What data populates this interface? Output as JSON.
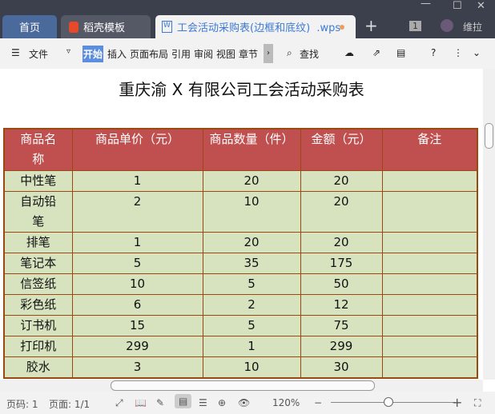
{
  "tabs": [
    {
      "label": "首页"
    },
    {
      "label": "稻壳模板"
    },
    {
      "label": "工会活动采购表(边框和底纹)  .wps"
    }
  ],
  "user": "维拉",
  "window_count": "1",
  "toolbar": {
    "menu": "文件",
    "items": [
      "开始",
      "插入",
      "页面布局",
      "引用",
      "审阅",
      "视图",
      "章节"
    ],
    "find": "查找"
  },
  "document": {
    "title": "重庆渝 X 有限公司工会活动采购表",
    "headers": [
      "商品名称",
      "商品单价（元）",
      "商品数量（件）",
      "金额（元）",
      "备注"
    ],
    "rows": [
      [
        "中性笔",
        "1",
        "20",
        "20",
        ""
      ],
      [
        "自动铅笔",
        "2",
        "10",
        "20",
        ""
      ],
      [
        "排笔",
        "1",
        "20",
        "20",
        ""
      ],
      [
        "笔记本",
        "5",
        "35",
        "175",
        ""
      ],
      [
        "信签纸",
        "10",
        "5",
        "50",
        ""
      ],
      [
        "彩色纸",
        "6",
        "2",
        "12",
        ""
      ],
      [
        "订书机",
        "15",
        "5",
        "75",
        ""
      ],
      [
        "打印机",
        "299",
        "1",
        "299",
        ""
      ],
      [
        "胶水",
        "3",
        "10",
        "30",
        ""
      ]
    ]
  },
  "status": {
    "page_no": "页码: 1",
    "pages": "页面: 1/1",
    "zoom": "120%",
    "zoom_level": 0.6
  },
  "colors": {
    "header": "#c0504f",
    "body": "#d7e3bf",
    "border": "#9a4a10"
  }
}
